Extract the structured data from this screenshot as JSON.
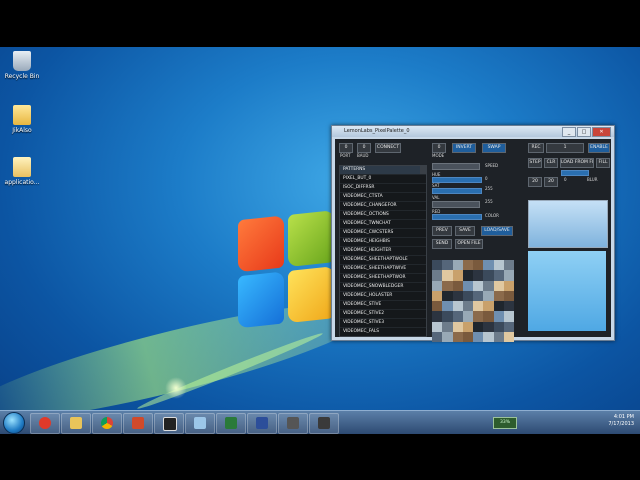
{
  "desktop": {
    "icons": [
      {
        "label": "Recycle Bin",
        "icon": "recycle-bin-icon"
      },
      {
        "label": "JikAlso",
        "icon": "folder-icon"
      },
      {
        "label": "applicatio...",
        "icon": "folder-icon"
      }
    ]
  },
  "app": {
    "title": "LemonLabs_PixelPalette_0",
    "window_buttons": [
      "_",
      "□",
      "✕"
    ],
    "top_left": {
      "field1": "0",
      "field2": "0",
      "connect": "CONNECT",
      "sub1": "PORT",
      "sub2": "BAUD"
    },
    "list_items": [
      "PATTERNS",
      "PIXEL_BUT_0",
      "ISOC_DIFFRSR",
      "VIDEOMEC_CTSTA",
      "VIDEOMEC_CHANGEFOR",
      "VIDEOMEC_OCTIONS",
      "VIDEOMEC_TWNCHAT",
      "VIDEOMEC_CWCSTERS",
      "VIDEOMEC_HEIGHBIS",
      "VIDEOMEC_HEIGHTER",
      "VIDEOMEC_SHEETHAPTWOLE",
      "VIDEOMEC_SHEETHAPTWIVE",
      "VIDEOMEC_SHEETHAPTWOR",
      "VIDEOMEC_SNOWBLEDGER",
      "VIDEOMEC_HOLASTER",
      "VIDEOMEC_STIVE",
      "VIDEOMEC_STIVE2",
      "VIDEOMEC_STIVE3",
      "VIDEOMEC_FALS",
      "VIDEOMEC_STIVE4",
      "VIDEOMEC_SFIRE",
      "VLEDE_BREEWAVE",
      "VLEDE_BREEWAVE"
    ],
    "mid": {
      "top_field": "0",
      "invert": "INVERT",
      "swap": "SWAP",
      "label_a": "MODE",
      "label_b": "SPEED",
      "label_c": "COLOR",
      "row_labels": [
        "HUE",
        "SAT",
        "VAL",
        "RED",
        "GRN"
      ],
      "row_values": [
        "0",
        "255",
        "255",
        "0",
        "0"
      ],
      "btns_row1": [
        "PREV",
        "SAVE",
        "LOAD/SAVE"
      ],
      "btns_row2": [
        "SEND",
        "OPEN FILE"
      ]
    },
    "right": {
      "field1": "REC",
      "field2": "1",
      "enable": "ENABLE",
      "btns": [
        "STEP",
        "CLR",
        "LOAD FROM FILE",
        "FILL"
      ],
      "n1": "20",
      "n2": "20",
      "n3": "0",
      "blur": "BLUR"
    }
  },
  "taskbar": {
    "battery": "33%",
    "clock_time": "4:01 PM",
    "clock_date": "7/17/2013"
  }
}
